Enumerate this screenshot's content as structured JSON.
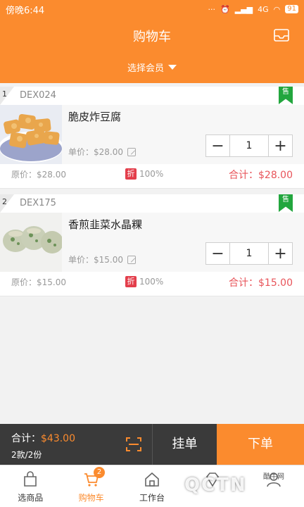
{
  "statusbar": {
    "time": "傍晚6:44",
    "network": "4G",
    "battery": "91"
  },
  "header": {
    "title": "购物车",
    "member_select": "选择会员"
  },
  "items": [
    {
      "index": "1",
      "code": "DEX024",
      "sale_tag": "售",
      "name": "脆皮炸豆腐",
      "unit_price": "单价：$28.00",
      "quantity": "1",
      "original_price": "原价：$28.00",
      "discount_badge": "折",
      "discount": "100%",
      "subtotal": "合计：$28.00"
    },
    {
      "index": "2",
      "code": "DEX175",
      "sale_tag": "售",
      "name": "香煎韭菜水晶粿",
      "unit_price": "单价：$15.00",
      "quantity": "1",
      "original_price": "原价：$15.00",
      "discount_badge": "折",
      "discount": "100%",
      "subtotal": "合计：$15.00"
    }
  ],
  "checkout": {
    "total_label": "合计：",
    "total_value": "$43.00",
    "count": "2款/2份",
    "hold_label": "挂单",
    "order_label": "下单"
  },
  "tabs": [
    {
      "label": "选商品"
    },
    {
      "label": "购物车",
      "badge": "2"
    },
    {
      "label": "工作台"
    },
    {
      "label": ""
    },
    {
      "label": ""
    }
  ],
  "watermark": {
    "text": "QCTN",
    "small": "酷牛网"
  },
  "colors": {
    "accent": "#fb8b2e",
    "price": "#e8545a",
    "sale": "#22a63e",
    "discount": "#e33e4b"
  }
}
